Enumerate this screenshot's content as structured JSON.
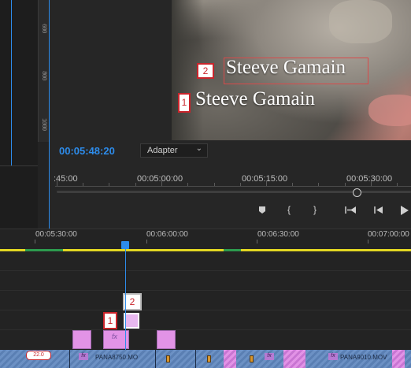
{
  "left_ruler": {
    "labels": [
      "600",
      "800",
      "1000"
    ]
  },
  "monitor": {
    "title_text_top": "Steeve Gamain",
    "title_text_bottom": "Steeve Gamain",
    "marker_top": "2",
    "marker_bottom": "1",
    "timecode": "00:05:48:20",
    "fit_dropdown": "Adapter",
    "ruler_labels": [
      ":45:00",
      "00:05:00:00",
      "00:05:15:00",
      "00:05:30:00"
    ],
    "controls": [
      "marker-icon",
      "mark-in-icon",
      "mark-out-icon",
      "go-to-in-icon",
      "step-back-icon",
      "play-icon"
    ]
  },
  "timeline": {
    "ruler_labels": [
      "00:05:30:00",
      "00:06:00:00",
      "00:06:30:00",
      "00:07:00:00"
    ],
    "marker_one": "1",
    "marker_two": "2",
    "fx_label": "fx",
    "clip_names": [
      "PANA8750.MO",
      "PANA9010.MOV"
    ],
    "badge_text": "22.0"
  },
  "colors": {
    "accent": "#2d8ceb",
    "marker_red": "#c9242b",
    "work_area": "#e2d622",
    "clip_pink": "#e293e6",
    "clip_blue": "#6c91c4"
  }
}
